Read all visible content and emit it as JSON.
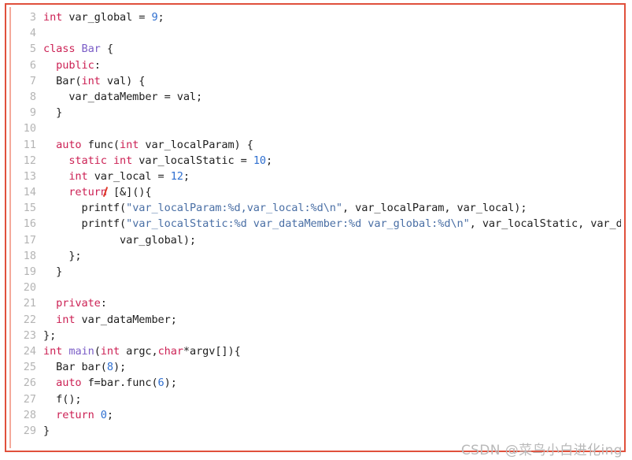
{
  "frame": {
    "border_color": "#e0503c",
    "inner_rule_color": "#f4a99a",
    "background": "#ffffff"
  },
  "palette": {
    "keyword": "#cc2255",
    "type": "#7b5ec7",
    "number": "#2f6fd0",
    "string": "#4a6fa5",
    "plain": "#202020",
    "line_number": "#b4b4b4",
    "watermark": "#b9b9b9",
    "caret": "#e03a28"
  },
  "editor": {
    "language": "C++",
    "first_line_number": 3,
    "last_line_number": 29,
    "lines": [
      {
        "n": "3",
        "tokens": [
          {
            "t": "int",
            "c": "kw"
          },
          {
            "t": " var_global = ",
            "c": "pl"
          },
          {
            "t": "9",
            "c": "num"
          },
          {
            "t": ";",
            "c": "pl"
          }
        ]
      },
      {
        "n": "4",
        "tokens": []
      },
      {
        "n": "5",
        "tokens": [
          {
            "t": "class",
            "c": "kw"
          },
          {
            "t": " ",
            "c": "pl"
          },
          {
            "t": "Bar",
            "c": "typ"
          },
          {
            "t": " {",
            "c": "pl"
          }
        ]
      },
      {
        "n": "6",
        "tokens": [
          {
            "t": "  ",
            "c": "pl"
          },
          {
            "t": "public",
            "c": "kw"
          },
          {
            "t": ":",
            "c": "pl"
          }
        ]
      },
      {
        "n": "7",
        "tokens": [
          {
            "t": "  Bar(",
            "c": "pl"
          },
          {
            "t": "int",
            "c": "kw"
          },
          {
            "t": " val) {",
            "c": "pl"
          }
        ]
      },
      {
        "n": "8",
        "tokens": [
          {
            "t": "    var_dataMember = val;",
            "c": "pl"
          }
        ]
      },
      {
        "n": "9",
        "tokens": [
          {
            "t": "  }",
            "c": "pl"
          }
        ]
      },
      {
        "n": "10",
        "tokens": []
      },
      {
        "n": "11",
        "tokens": [
          {
            "t": "  ",
            "c": "pl"
          },
          {
            "t": "auto",
            "c": "kw"
          },
          {
            "t": " func(",
            "c": "pl"
          },
          {
            "t": "int",
            "c": "kw"
          },
          {
            "t": " var_localParam) {",
            "c": "pl"
          }
        ]
      },
      {
        "n": "12",
        "tokens": [
          {
            "t": "    ",
            "c": "pl"
          },
          {
            "t": "static",
            "c": "kw"
          },
          {
            "t": " ",
            "c": "pl"
          },
          {
            "t": "int",
            "c": "kw"
          },
          {
            "t": " var_localStatic = ",
            "c": "pl"
          },
          {
            "t": "10",
            "c": "num"
          },
          {
            "t": ";",
            "c": "pl"
          }
        ]
      },
      {
        "n": "13",
        "tokens": [
          {
            "t": "    ",
            "c": "pl"
          },
          {
            "t": "int",
            "c": "kw"
          },
          {
            "t": " var_local = ",
            "c": "pl"
          },
          {
            "t": "12",
            "c": "num"
          },
          {
            "t": ";",
            "c": "pl"
          }
        ]
      },
      {
        "n": "14",
        "tokens": [
          {
            "t": "    ",
            "c": "pl"
          },
          {
            "t": "return",
            "c": "kw"
          },
          {
            "t": " [&](){",
            "c": "pl"
          }
        ],
        "caret_after": 1
      },
      {
        "n": "15",
        "tokens": [
          {
            "t": "      printf(",
            "c": "pl"
          },
          {
            "t": "\"var_localParam:%d,var_local:%d\\n\"",
            "c": "str"
          },
          {
            "t": ", var_localParam, var_local);",
            "c": "pl"
          }
        ]
      },
      {
        "n": "16",
        "tokens": [
          {
            "t": "      printf(",
            "c": "pl"
          },
          {
            "t": "\"var_localStatic:%d var_dataMember:%d var_global:%d\\n\"",
            "c": "str"
          },
          {
            "t": ", var_localStatic, var_dataMember,",
            "c": "pl"
          }
        ]
      },
      {
        "n": "17",
        "tokens": [
          {
            "t": "            var_global);",
            "c": "pl"
          }
        ]
      },
      {
        "n": "18",
        "tokens": [
          {
            "t": "    };",
            "c": "pl"
          }
        ]
      },
      {
        "n": "19",
        "tokens": [
          {
            "t": "  }",
            "c": "pl"
          }
        ]
      },
      {
        "n": "20",
        "tokens": []
      },
      {
        "n": "21",
        "tokens": [
          {
            "t": "  ",
            "c": "pl"
          },
          {
            "t": "private",
            "c": "kw"
          },
          {
            "t": ":",
            "c": "pl"
          }
        ]
      },
      {
        "n": "22",
        "tokens": [
          {
            "t": "  ",
            "c": "pl"
          },
          {
            "t": "int",
            "c": "kw"
          },
          {
            "t": " var_dataMember;",
            "c": "pl"
          }
        ]
      },
      {
        "n": "23",
        "tokens": [
          {
            "t": "};",
            "c": "pl"
          }
        ]
      },
      {
        "n": "24",
        "tokens": [
          {
            "t": "int",
            "c": "kw"
          },
          {
            "t": " ",
            "c": "pl"
          },
          {
            "t": "main",
            "c": "typ"
          },
          {
            "t": "(",
            "c": "pl"
          },
          {
            "t": "int",
            "c": "kw"
          },
          {
            "t": " argc,",
            "c": "pl"
          },
          {
            "t": "char",
            "c": "kw"
          },
          {
            "t": "*argv[]){",
            "c": "pl"
          }
        ]
      },
      {
        "n": "25",
        "tokens": [
          {
            "t": "  Bar bar(",
            "c": "pl"
          },
          {
            "t": "8",
            "c": "num"
          },
          {
            "t": ");",
            "c": "pl"
          }
        ]
      },
      {
        "n": "26",
        "tokens": [
          {
            "t": "  ",
            "c": "pl"
          },
          {
            "t": "auto",
            "c": "kw"
          },
          {
            "t": " f=bar.func(",
            "c": "pl"
          },
          {
            "t": "6",
            "c": "num"
          },
          {
            "t": ");",
            "c": "pl"
          }
        ]
      },
      {
        "n": "27",
        "tokens": [
          {
            "t": "  f();",
            "c": "pl"
          }
        ]
      },
      {
        "n": "28",
        "tokens": [
          {
            "t": "  ",
            "c": "pl"
          },
          {
            "t": "return",
            "c": "kw"
          },
          {
            "t": " ",
            "c": "pl"
          },
          {
            "t": "0",
            "c": "num"
          },
          {
            "t": ";",
            "c": "pl"
          }
        ]
      },
      {
        "n": "29",
        "tokens": [
          {
            "t": "}",
            "c": "pl"
          }
        ]
      }
    ]
  },
  "watermark": {
    "text": "CSDN @菜鸟小白进化ing"
  }
}
